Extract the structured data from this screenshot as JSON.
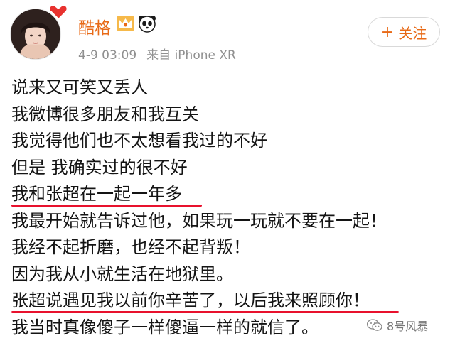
{
  "post": {
    "username": "酷格",
    "timestamp": "4-9 03:09",
    "source": "来自 iPhone XR",
    "follow_label": "关注"
  },
  "content": {
    "lines": [
      "说来又可笑又丢人",
      "我微博很多朋友和我互关",
      "我觉得他们也不太想看我过的不好",
      "但是 我确实过的很不好",
      "我和张超在一起一年多",
      "我最开始就告诉过他，如果玩一玩就不要在一起！",
      "我经不起折磨，也经不起背叛！",
      "因为我从小就生活在地狱里。",
      "张超说遇见我以前你辛苦了，以后我来照顾你！",
      "我当时真像傻子一样傻逼一样的就信了。"
    ],
    "highlighted_lines": [
      5,
      9
    ]
  },
  "watermark": {
    "text": "8号风暴"
  },
  "icons": {
    "avatar_badge": "heart-badge-icon",
    "vip": "crown-vip-icon",
    "panda": "panda-icon",
    "follow": "plus-icon",
    "watermark": "wechat-icon"
  },
  "colors": {
    "username": "#e86a17",
    "follow_text": "#e86a17",
    "meta": "#909090",
    "highlight_underline": "#e8112d",
    "body_text": "#141414"
  }
}
